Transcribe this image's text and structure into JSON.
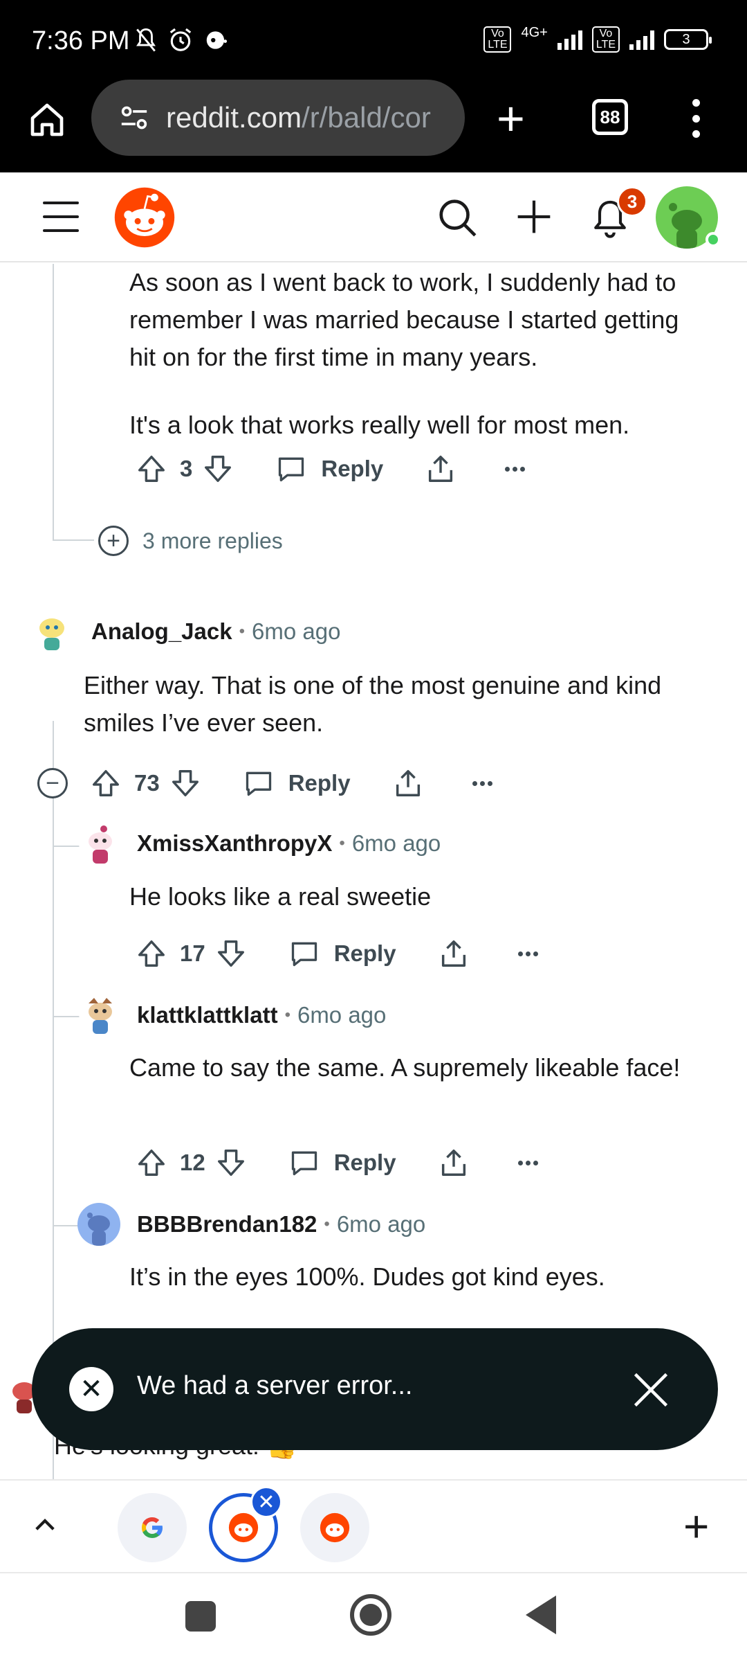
{
  "status_bar": {
    "time": "7:36 PM",
    "network": "4G+",
    "battery": "3"
  },
  "browser": {
    "url_host": "reddit.com",
    "url_path": "/r/bald/cor",
    "tab_count": "88"
  },
  "header": {
    "notification_count": "3"
  },
  "comments": {
    "c0": {
      "text_p1": "As soon as I went back to work, I suddenly had to remember I was married because I started getting hit on for the first time in many years.",
      "text_p2": "It's a look that works really well for most men.",
      "score": "3",
      "reply_label": "Reply"
    },
    "more_replies": "3 more replies",
    "c1": {
      "user": "Analog_Jack",
      "time": "6mo ago",
      "text": "Either way. That is one of the most genuine and kind smiles I’ve ever seen.",
      "score": "73",
      "reply_label": "Reply"
    },
    "c2": {
      "user": "XmissXanthropyX",
      "time": "6mo ago",
      "text": "He looks like a real sweetie",
      "score": "17",
      "reply_label": "Reply"
    },
    "c3": {
      "user": "klattklattklatt",
      "time": "6mo ago",
      "text": "Came to say the same. A supremely likeable face!",
      "score": "12",
      "reply_label": "Reply"
    },
    "c4": {
      "user": "BBBBrendan182",
      "time": "6mo ago",
      "text": "It’s in the eyes 100%. Dudes got kind eyes."
    },
    "c5": {
      "text": "He's looking great! 👍"
    }
  },
  "toast": {
    "message": "We had a server error..."
  },
  "colors": {
    "reddit_orange": "#ff4500",
    "toast_bg": "#0e1a1c",
    "active_tab": "#1a57d6",
    "badge": "#d93a00"
  }
}
